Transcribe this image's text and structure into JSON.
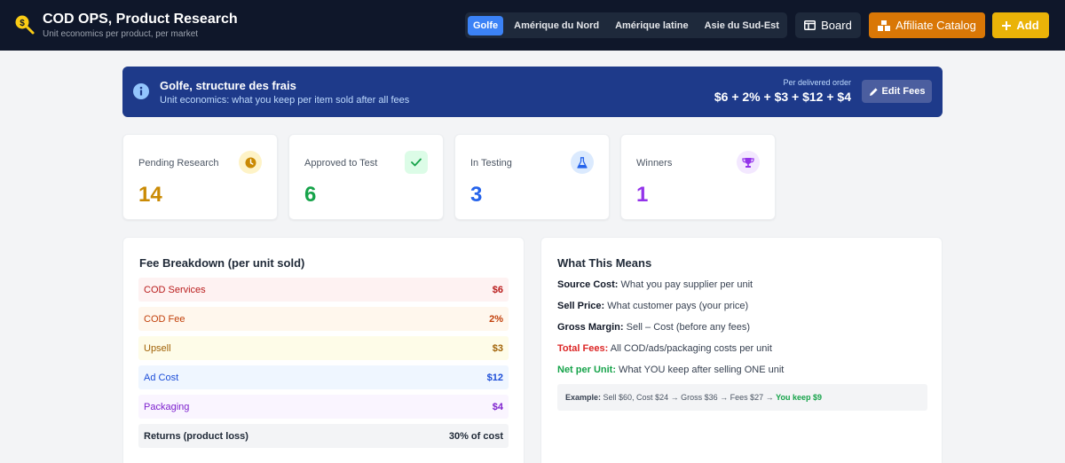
{
  "header": {
    "title": "COD OPS, Product Research",
    "subtitle": "Unit economics per product, per market",
    "markets": [
      "Golfe",
      "Amérique du Nord",
      "Amérique latine",
      "Asie du Sud-Est"
    ],
    "active_market_index": 0,
    "board_label": "Board",
    "affiliate_label": "Affiliate Catalog",
    "add_label": "Add"
  },
  "banner": {
    "title": "Golfe, structure des frais",
    "subtitle": "Unit economics: what you keep per item sold after all fees",
    "formula_label": "Per delivered order",
    "formula": "$6 + 2% + $3 + $12 + $4",
    "edit_label": "Edit Fees"
  },
  "stats": [
    {
      "label": "Pending Research",
      "value": "14",
      "color": "#ca8a04",
      "icon": "clock-icon"
    },
    {
      "label": "Approved to Test",
      "value": "6",
      "color": "#16a34a",
      "icon": "check-icon"
    },
    {
      "label": "In Testing",
      "value": "3",
      "color": "#2563eb",
      "icon": "flask-icon"
    },
    {
      "label": "Winners",
      "value": "1",
      "color": "#9333ea",
      "icon": "trophy-icon"
    }
  ],
  "fees": {
    "title": "Fee Breakdown (per unit sold)",
    "rows": [
      {
        "label": "COD Services",
        "value": "$6"
      },
      {
        "label": "COD Fee",
        "value": "2%"
      },
      {
        "label": "Upsell",
        "value": "$3"
      },
      {
        "label": "Ad Cost",
        "value": "$12"
      },
      {
        "label": "Packaging",
        "value": "$4"
      },
      {
        "label": "Returns (product loss)",
        "value": "30% of cost"
      }
    ]
  },
  "meaning": {
    "title": "What This Means",
    "lines": [
      {
        "term": "Source Cost:",
        "desc": " What you pay supplier per unit"
      },
      {
        "term": "Sell Price:",
        "desc": " What customer pays (your price)"
      },
      {
        "term": "Gross Margin:",
        "desc": " Sell – Cost (before any fees)"
      },
      {
        "term": "Total Fees:",
        "desc": " All COD/ads/packaging costs per unit"
      },
      {
        "term": "Net per Unit:",
        "desc": " What YOU keep after selling ONE unit"
      }
    ],
    "example_label": "Example:",
    "example_text": " Sell $60, Cost $24 → Gross $36 → Fees $27 → ",
    "example_result": "You keep $9"
  },
  "colors": {
    "header_bg": "#0f172a",
    "active_tab": "#3b82f6",
    "affiliate": "#d97706",
    "add": "#eab308",
    "banner_bg": "#1e3a8a"
  }
}
